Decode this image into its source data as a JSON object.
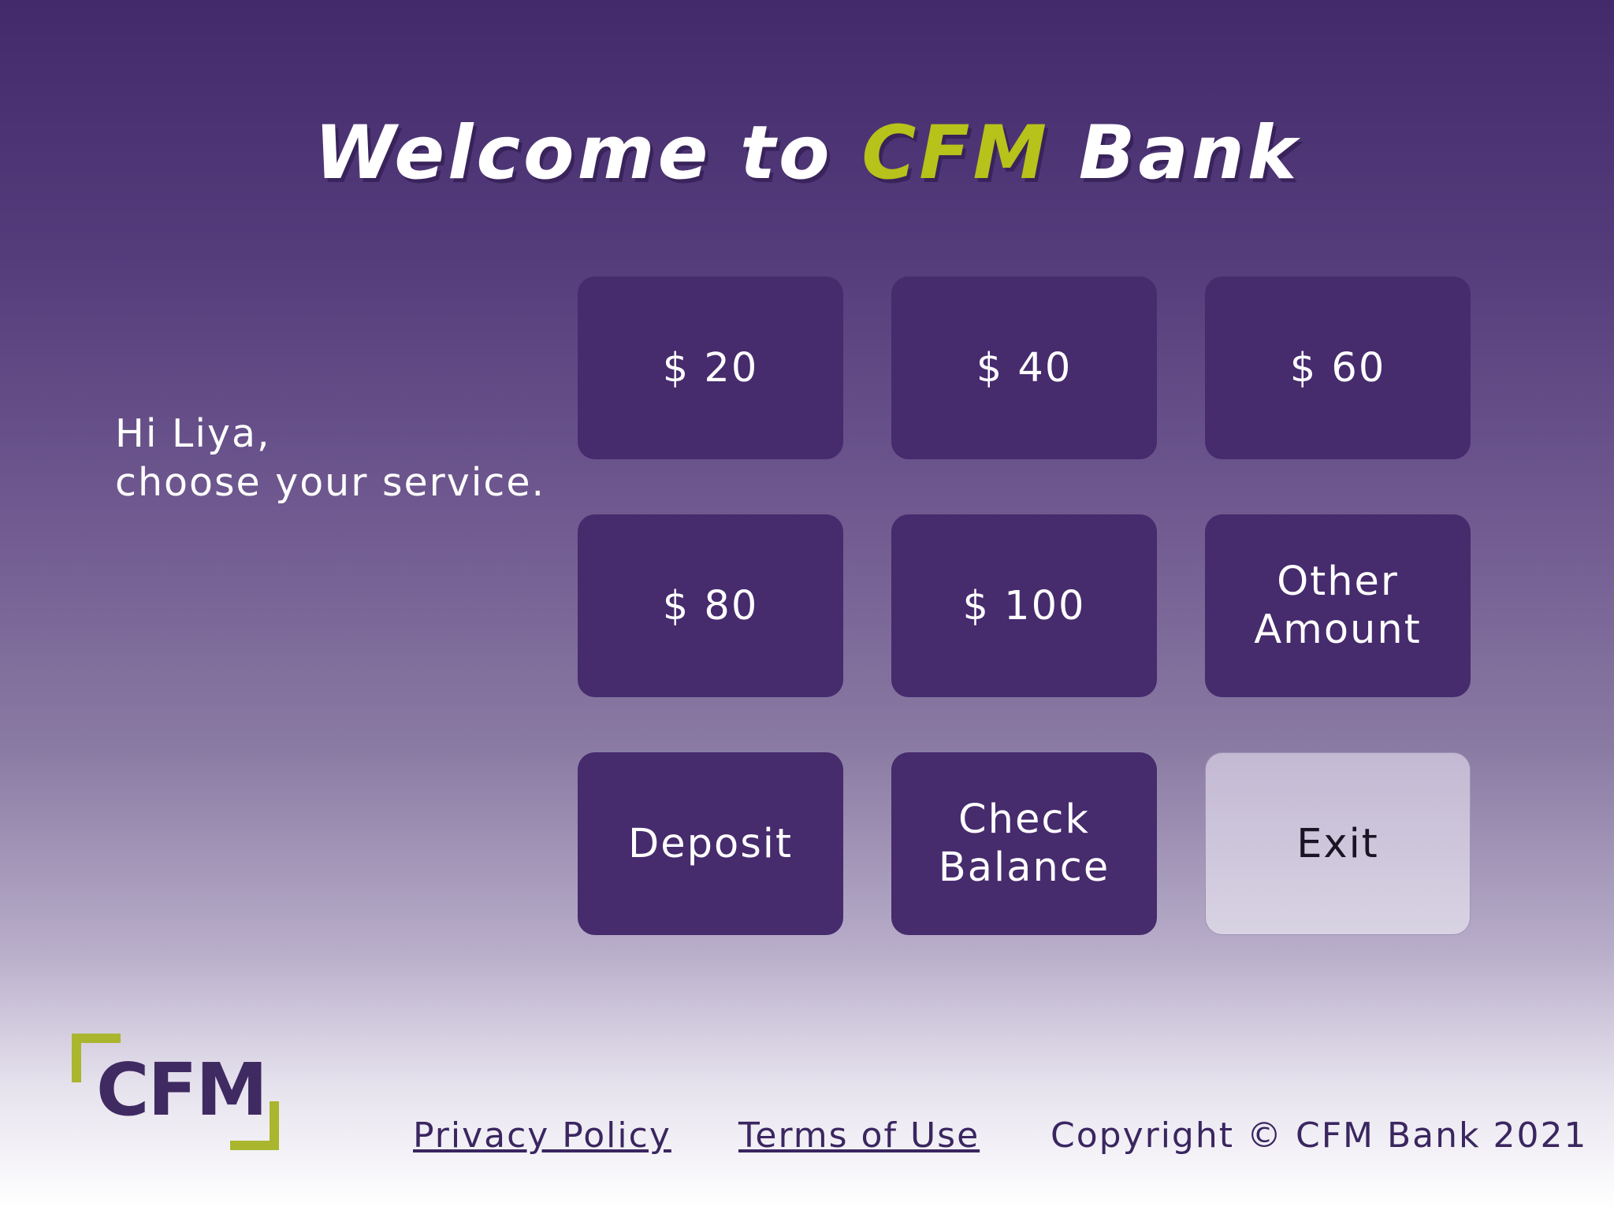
{
  "header": {
    "title_prefix": "Welcome to ",
    "title_brand": "CFM",
    "title_suffix": " Bank",
    "brand_color": "#b7c21a"
  },
  "greeting": {
    "line1": "Hi Liya,",
    "line2": "choose your service."
  },
  "buttons": {
    "amount_20": "$ 20",
    "amount_40": "$ 40",
    "amount_60": "$ 60",
    "amount_80": "$ 80",
    "amount_100": "$ 100",
    "other_line1": "Other",
    "other_line2": "Amount",
    "deposit": "Deposit",
    "check_line1": "Check",
    "check_line2": "Balance",
    "exit": "Exit",
    "button_color": "#462b6d",
    "exit_color": "#d0c8de"
  },
  "logo": {
    "text": "CFM",
    "text_color": "#3f2a62",
    "bracket_color": "#a9b62e"
  },
  "footer": {
    "privacy": "Privacy Policy",
    "terms": "Terms of Use",
    "copyright": "Copyright © CFM Bank 2021"
  }
}
